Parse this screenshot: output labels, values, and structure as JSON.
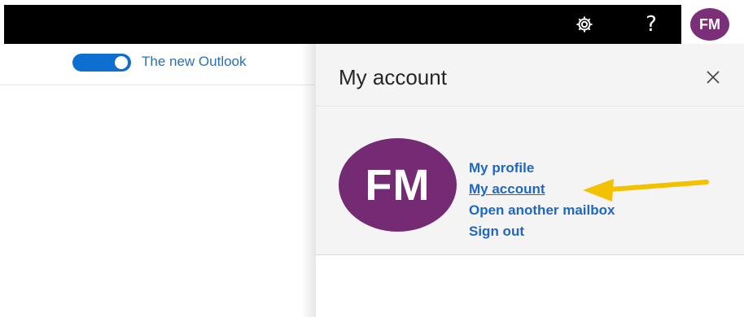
{
  "header": {
    "settings_icon": "gear-icon",
    "help_label": "?",
    "avatar_initials": "FM"
  },
  "toolbar": {
    "toggle_state": "on",
    "new_outlook_label": "The new Outlook"
  },
  "account_panel": {
    "title": "My account",
    "close_icon": "close-icon",
    "avatar_initials": "FM",
    "links": [
      {
        "label": "My profile"
      },
      {
        "label": "My account"
      },
      {
        "label": "Open another mailbox"
      },
      {
        "label": "Sign out"
      }
    ],
    "highlight_arrow_color": "#f2c200"
  },
  "colors": {
    "header_bg": "#000000",
    "avatar_bg": "#742b74",
    "link": "#1e68c4",
    "toggle": "#0f6fd1"
  }
}
